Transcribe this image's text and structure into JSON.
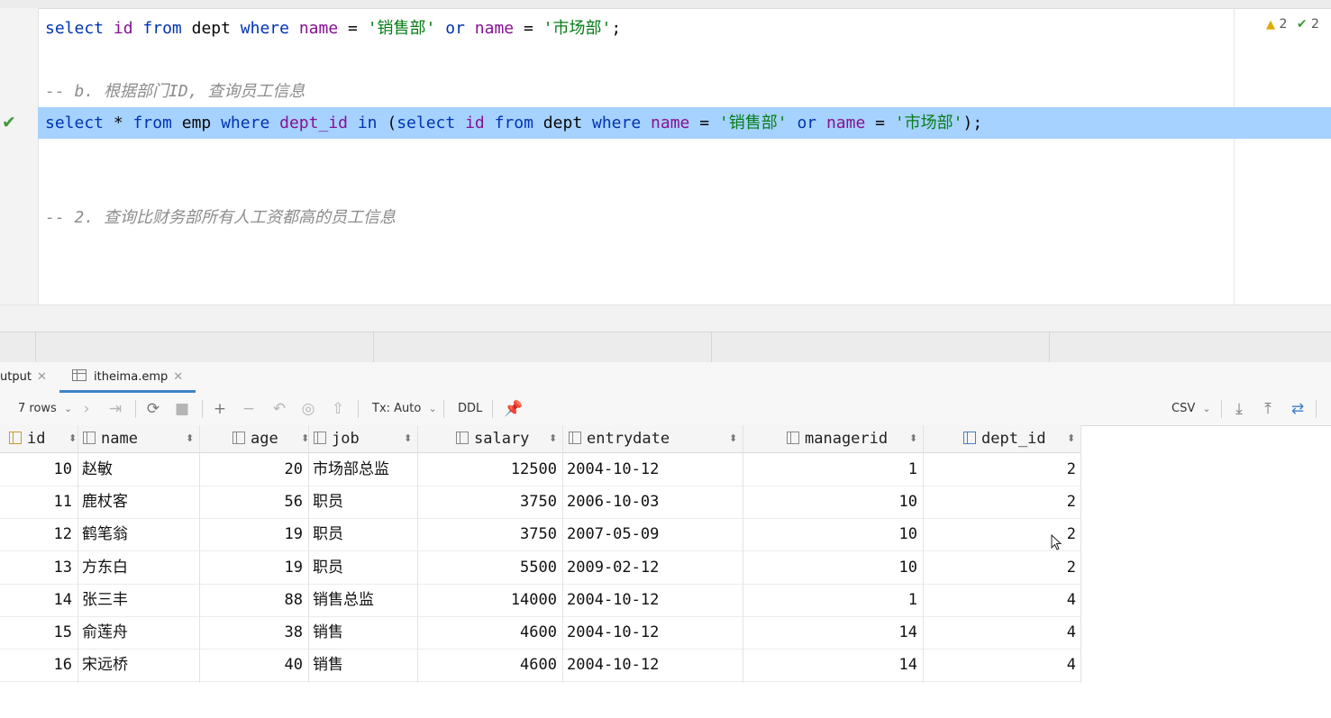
{
  "editor": {
    "inspections": {
      "warnings": "2",
      "ok": "2"
    },
    "lines": [
      {
        "tokens": [
          {
            "t": "select",
            "c": "kw"
          },
          {
            "t": " "
          },
          {
            "t": "id",
            "c": "id"
          },
          {
            "t": " "
          },
          {
            "t": "from",
            "c": "kw"
          },
          {
            "t": " dept "
          },
          {
            "t": "where",
            "c": "kw"
          },
          {
            "t": " "
          },
          {
            "t": "name",
            "c": "id"
          },
          {
            "t": " = "
          },
          {
            "t": "'销售部'",
            "c": "str"
          },
          {
            "t": " "
          },
          {
            "t": "or",
            "c": "kw"
          },
          {
            "t": " "
          },
          {
            "t": "name",
            "c": "id"
          },
          {
            "t": " = "
          },
          {
            "t": "'市场部'",
            "c": "str"
          },
          {
            "t": ";"
          }
        ]
      },
      {
        "tokens": [
          {
            "t": "-- b. 根据部门ID, 查询员工信息",
            "c": "cm"
          }
        ]
      },
      {
        "tokens": [
          {
            "t": "select",
            "c": "kw"
          },
          {
            "t": " * "
          },
          {
            "t": "from",
            "c": "kw"
          },
          {
            "t": " emp "
          },
          {
            "t": "where",
            "c": "kw"
          },
          {
            "t": " "
          },
          {
            "t": "dept_id",
            "c": "id"
          },
          {
            "t": " "
          },
          {
            "t": "in",
            "c": "kw"
          },
          {
            "t": " ("
          },
          {
            "t": "select",
            "c": "kw"
          },
          {
            "t": " "
          },
          {
            "t": "id",
            "c": "id"
          },
          {
            "t": " "
          },
          {
            "t": "from",
            "c": "kw"
          },
          {
            "t": " dept "
          },
          {
            "t": "where",
            "c": "kw"
          },
          {
            "t": " "
          },
          {
            "t": "name",
            "c": "id"
          },
          {
            "t": " = "
          },
          {
            "t": "'销售部'",
            "c": "str"
          },
          {
            "t": " "
          },
          {
            "t": "or",
            "c": "kw"
          },
          {
            "t": " "
          },
          {
            "t": "name",
            "c": "id"
          },
          {
            "t": " = "
          },
          {
            "t": "'市场部'",
            "c": "str"
          },
          {
            "t": ");"
          }
        ]
      },
      {
        "tokens": [
          {
            "t": "-- 2. 查询比财务部所有人工资都高的员工信息",
            "c": "cm"
          }
        ]
      }
    ]
  },
  "result_tabs": [
    {
      "label": "utput"
    },
    {
      "label": "itheima.emp"
    }
  ],
  "toolbar": {
    "rows_label": "7 rows",
    "tx_label": "Tx: Auto",
    "ddl_label": "DDL",
    "csv_label": "CSV"
  },
  "table": {
    "columns": [
      "id",
      "name",
      "age",
      "job",
      "salary",
      "entrydate",
      "managerid",
      "dept_id"
    ],
    "rows": [
      [
        "10",
        "赵敏",
        "20",
        "市场部总监",
        "12500",
        "2004-10-12",
        "1",
        "2"
      ],
      [
        "11",
        "鹿杖客",
        "56",
        "职员",
        "3750",
        "2006-10-03",
        "10",
        "2"
      ],
      [
        "12",
        "鹤笔翁",
        "19",
        "职员",
        "3750",
        "2007-05-09",
        "10",
        "2"
      ],
      [
        "13",
        "方东白",
        "19",
        "职员",
        "5500",
        "2009-02-12",
        "10",
        "2"
      ],
      [
        "14",
        "张三丰",
        "88",
        "销售总监",
        "14000",
        "2004-10-12",
        "1",
        "4"
      ],
      [
        "15",
        "俞莲舟",
        "38",
        "销售",
        "4600",
        "2004-10-12",
        "14",
        "4"
      ],
      [
        "16",
        "宋远桥",
        "40",
        "销售",
        "4600",
        "2004-10-12",
        "14",
        "4"
      ]
    ]
  }
}
